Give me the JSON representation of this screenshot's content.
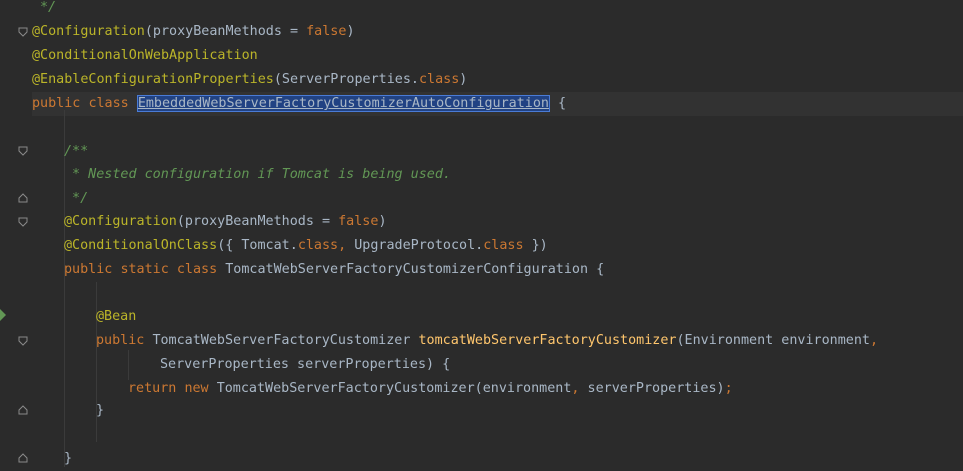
{
  "editor": {
    "lines": {
      "l0": "*/",
      "l1_ann": "@Configuration",
      "l1_rest": "(proxyBeanMethods = ",
      "l1_false": "false",
      "l1_close": ")",
      "l2": "@ConditionalOnWebApplication",
      "l3_ann": "@EnableConfigurationProperties",
      "l3_a": "(ServerProperties.",
      "l3_class": "class",
      "l3_close": ")",
      "l4_public": "public",
      "l4_class": "class",
      "l4_name": "EmbeddedWebServerFactoryCustomizerAutoConfiguration",
      "l4_brace": "{",
      "l6": "/**",
      "l7": " * Nested configuration if Tomcat is being used.",
      "l8": " */",
      "l9_ann": "@Configuration",
      "l9_rest": "(proxyBeanMethods = ",
      "l9_false": "false",
      "l9_close": ")",
      "l10_ann": "@ConditionalOnClass",
      "l10_a": "({ Tomcat.",
      "l10_class1": "class",
      "l10_comma": ", ",
      "l10_b": "UpgradeProtocol.",
      "l10_class2": "class",
      "l10_close": " })",
      "l11_public": "public",
      "l11_static": "static",
      "l11_class": "class",
      "l11_name": "TomcatWebServerFactoryCustomizerConfiguration {",
      "l13": "@Bean",
      "l14_public": "public",
      "l14_type": "TomcatWebServerFactoryCustomizer",
      "l14_fn": "tomcatWebServerFactoryCustomizer",
      "l14_args": "(Environment environment",
      "l14_comma": ",",
      "l15": "ServerProperties serverProperties) {",
      "l16_return": "return",
      "l16_new": "new",
      "l16_a": "TomcatWebServerFactoryCustomizer(environment",
      "l16_comma": ",",
      "l16_b": " serverProperties)",
      "l16_semi": ";",
      "l17": "}",
      "l19": "}"
    }
  },
  "colors": {
    "background": "#2b2b2b",
    "keyword": "#cc7832",
    "annotation": "#bbb529",
    "comment": "#629755",
    "method": "#ffc66d",
    "text": "#a9b7c6",
    "selection": "#214283"
  }
}
